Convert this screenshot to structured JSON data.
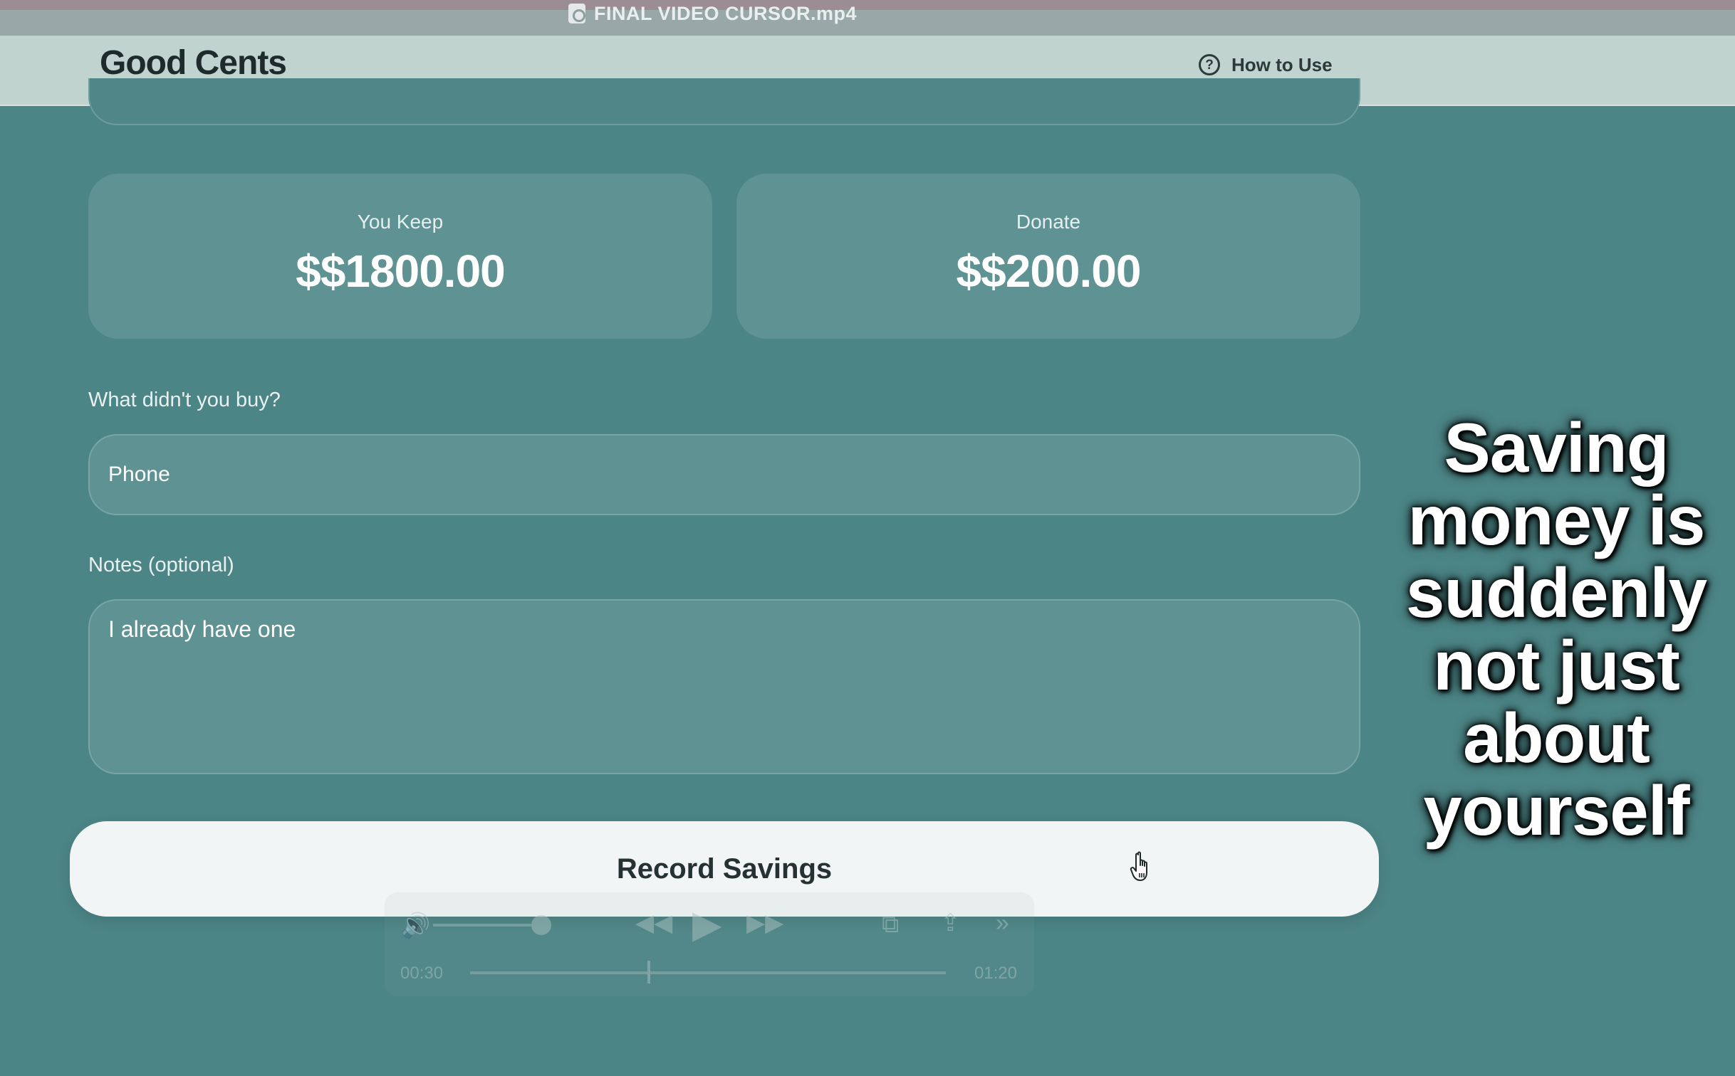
{
  "window": {
    "title": "FINAL VIDEO CURSOR.mp4"
  },
  "header": {
    "brand": "Good Cents",
    "help_label": "How to Use"
  },
  "split": {
    "keep_label": "You Keep",
    "keep_value": "$$1800.00",
    "donate_label": "Donate",
    "donate_value": "$$200.00"
  },
  "form": {
    "item_label": "What didn't you buy?",
    "item_value": "Phone",
    "notes_label": "Notes (optional)",
    "notes_value": "I already have one",
    "submit_label": "Record Savings"
  },
  "player": {
    "current_time": "00:30",
    "duration": "01:20",
    "progress": 0.375
  },
  "caption": {
    "text": "Saving money is suddenly not just about yourself"
  },
  "icons": {
    "help": "question-circle-icon",
    "cursor": "hand-pointer-icon"
  },
  "colors": {
    "background": "#4c8586",
    "header": "#c0d3cf",
    "card": "#5f9292",
    "button": "#f1f5f5"
  }
}
